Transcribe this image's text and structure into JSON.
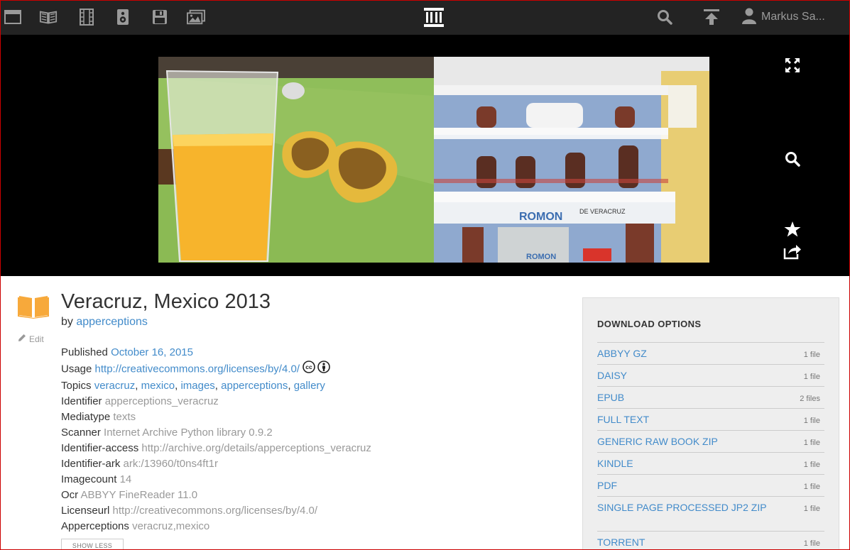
{
  "nav": {
    "icons": [
      "web-icon",
      "texts-icon",
      "video-icon",
      "audio-icon",
      "software-icon",
      "images-icon"
    ],
    "user_name": "Markus Sa..."
  },
  "item": {
    "title": "Veracruz, Mexico 2013",
    "by_label": "by",
    "author": "apperceptions",
    "edit_label": "Edit",
    "metadata": [
      {
        "key": "Published",
        "value": "October 16, 2015",
        "type": "link"
      },
      {
        "key": "Usage",
        "value": "http://creativecommons.org/licenses/by/4.0/",
        "type": "link"
      },
      {
        "key": "Topics",
        "value": "",
        "type": "topics"
      },
      {
        "key": "Identifier",
        "value": "apperceptions_veracruz",
        "type": "plain"
      },
      {
        "key": "Mediatype",
        "value": "texts",
        "type": "plain"
      },
      {
        "key": "Scanner",
        "value": "Internet Archive Python library 0.9.2",
        "type": "plain"
      },
      {
        "key": "Identifier-access",
        "value": "http://archive.org/details/apperceptions_veracruz",
        "type": "plain"
      },
      {
        "key": "Identifier-ark",
        "value": "ark:/13960/t0ns4ft1r",
        "type": "plain"
      },
      {
        "key": "Imagecount",
        "value": "14",
        "type": "plain"
      },
      {
        "key": "Ocr",
        "value": "ABBYY FineReader 11.0",
        "type": "plain"
      },
      {
        "key": "Licenseurl",
        "value": "http://creativecommons.org/licenses/by/4.0/",
        "type": "plain"
      },
      {
        "key": "Apperceptions",
        "value": "veracruz,mexico",
        "type": "plain"
      }
    ],
    "topics": [
      "veracruz",
      "mexico",
      "images",
      "apperceptions",
      "gallery"
    ],
    "show_less_label": "SHOW LESS"
  },
  "downloads": {
    "heading": "DOWNLOAD OPTIONS",
    "items": [
      {
        "name": "ABBYY GZ",
        "count": "1 file"
      },
      {
        "name": "DAISY",
        "count": "1 file"
      },
      {
        "name": "EPUB",
        "count": "2 files"
      },
      {
        "name": "FULL TEXT",
        "count": "1 file"
      },
      {
        "name": "GENERIC RAW BOOK ZIP",
        "count": "1 file"
      },
      {
        "name": "KINDLE",
        "count": "1 file"
      },
      {
        "name": "PDF",
        "count": "1 file"
      },
      {
        "name": "SINGLE PAGE PROCESSED JP2 ZIP",
        "count": "1 file"
      }
    ],
    "torrent": {
      "name": "TORRENT",
      "count": "1 file"
    }
  },
  "colors": {
    "nav_bg": "#232323",
    "link": "#428bca",
    "book_orange": "#f7a93b",
    "panel_bg": "#eeeeee"
  }
}
